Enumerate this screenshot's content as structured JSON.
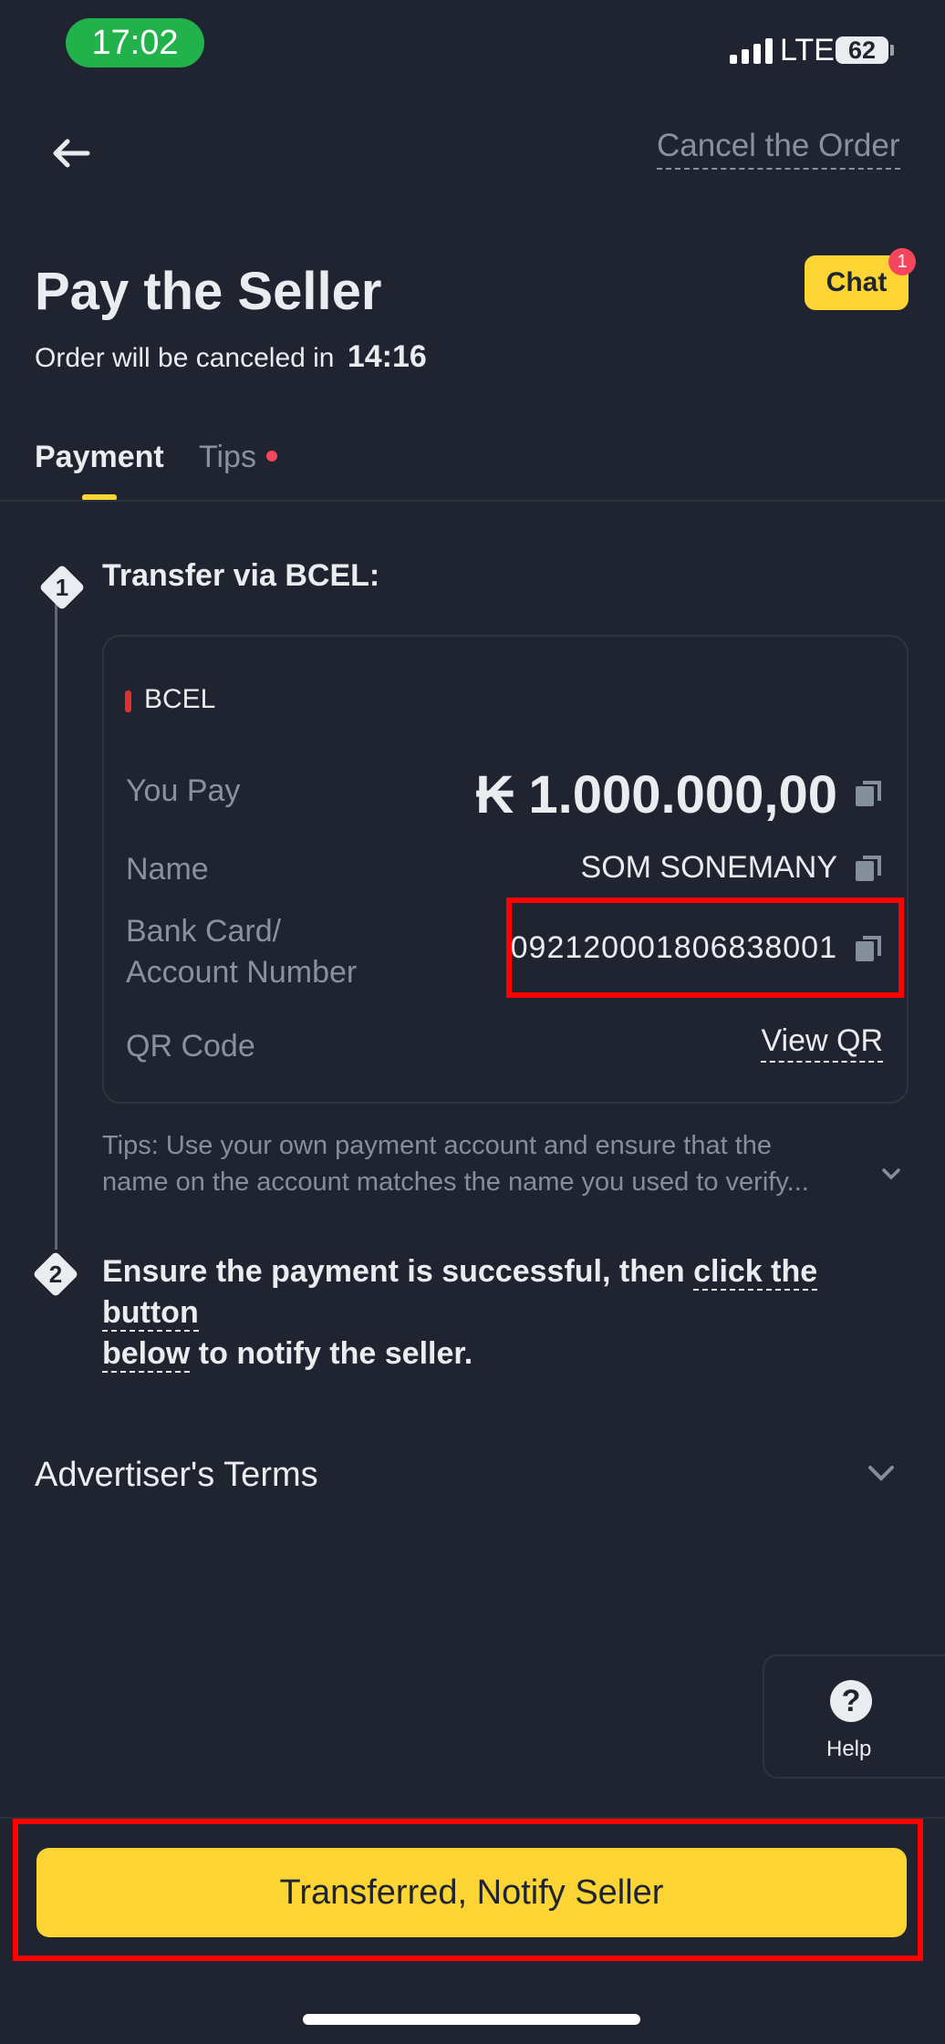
{
  "status_bar": {
    "time": "17:02",
    "network": "LTE",
    "battery": "62"
  },
  "header": {
    "cancel_label": "Cancel the Order",
    "chat_label": "Chat",
    "chat_badge": "1"
  },
  "page": {
    "title": "Pay the Seller",
    "countdown_prefix": "Order will be canceled in",
    "countdown": "14:16"
  },
  "tabs": [
    {
      "label": "Payment",
      "active": true
    },
    {
      "label": "Tips",
      "has_dot": true
    }
  ],
  "step1": {
    "number": "1",
    "title_prefix": "Transfer via",
    "title_bank": "BCEL:",
    "bank_name": "BCEL",
    "rows": {
      "you_pay_label": "You Pay",
      "you_pay_value": "₭ 1.000.000,00",
      "name_label": "Name",
      "name_value": "SOM SONEMANY",
      "account_label_1": "Bank Card/",
      "account_label_2": "Account Number",
      "account_value": "09212000180683800​1",
      "qr_label": "QR Code",
      "qr_link": "View QR"
    },
    "tips_line1": "Tips: Use your own payment account and ensure that the",
    "tips_line2": "name on the account matches the name you used to verify..."
  },
  "step2": {
    "number": "2",
    "text_a": "Ensure the payment is successful, then ",
    "text_link_a": "click the button",
    "text_link_b": "below",
    "text_b": " to notify the seller."
  },
  "terms_label": "Advertiser's Terms",
  "help_label": "Help",
  "primary_button": "Transferred, Notify Seller",
  "colors": {
    "accent": "#fcd535",
    "background": "#1f2430",
    "highlight": "#ff0000",
    "badge": "#f6465d"
  }
}
